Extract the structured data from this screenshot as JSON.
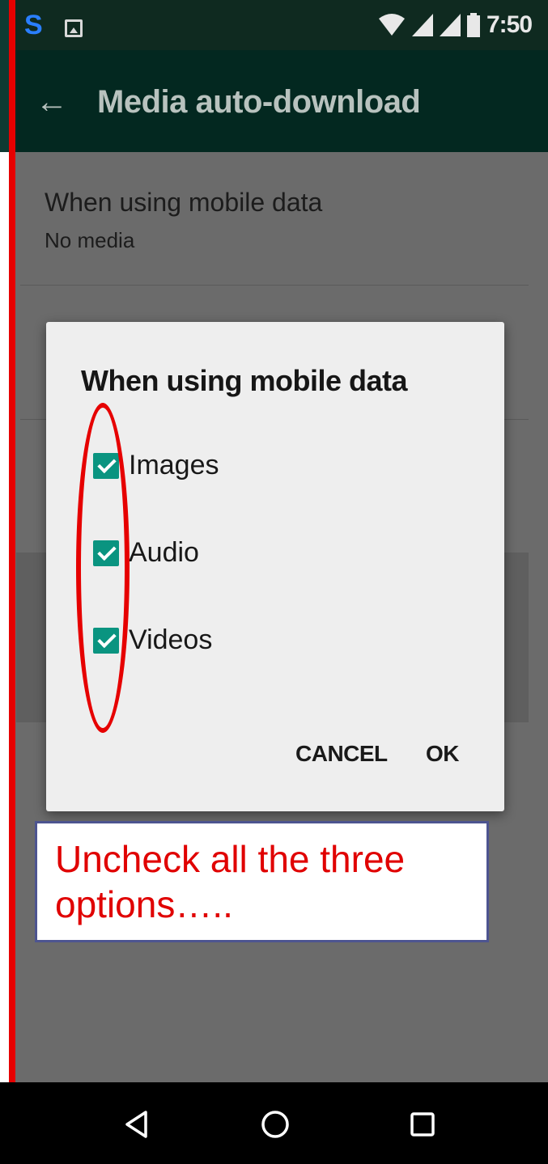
{
  "status_bar": {
    "time": "7:50",
    "left_icons": [
      "sync-s-icon",
      "image-icon"
    ],
    "right_icons": [
      "wifi-icon",
      "signal-icon",
      "signal-icon",
      "battery-icon"
    ],
    "s_glyph": "S"
  },
  "app_bar": {
    "title": "Media auto-download",
    "back_icon": "back-arrow-icon",
    "back_glyph": "←"
  },
  "settings": {
    "mobile_data": {
      "title": "When using mobile data",
      "value": "No media"
    }
  },
  "dialog": {
    "title": "When using mobile data",
    "options": [
      {
        "label": "Images",
        "checked": true
      },
      {
        "label": "Audio",
        "checked": true
      },
      {
        "label": "Videos",
        "checked": true
      }
    ],
    "cancel_label": "CANCEL",
    "ok_label": "OK"
  },
  "annotation": {
    "note": "Uncheck all the three options…..",
    "colors": {
      "highlight": "#e60000",
      "note_border": "#4d5490"
    }
  },
  "nav_bar": {
    "icons": [
      "back-triangle-icon",
      "home-circle-icon",
      "recents-square-icon"
    ]
  },
  "colors": {
    "accent": "#0a9480",
    "app_bar": "#032820",
    "status_bar": "#0f2a20"
  }
}
